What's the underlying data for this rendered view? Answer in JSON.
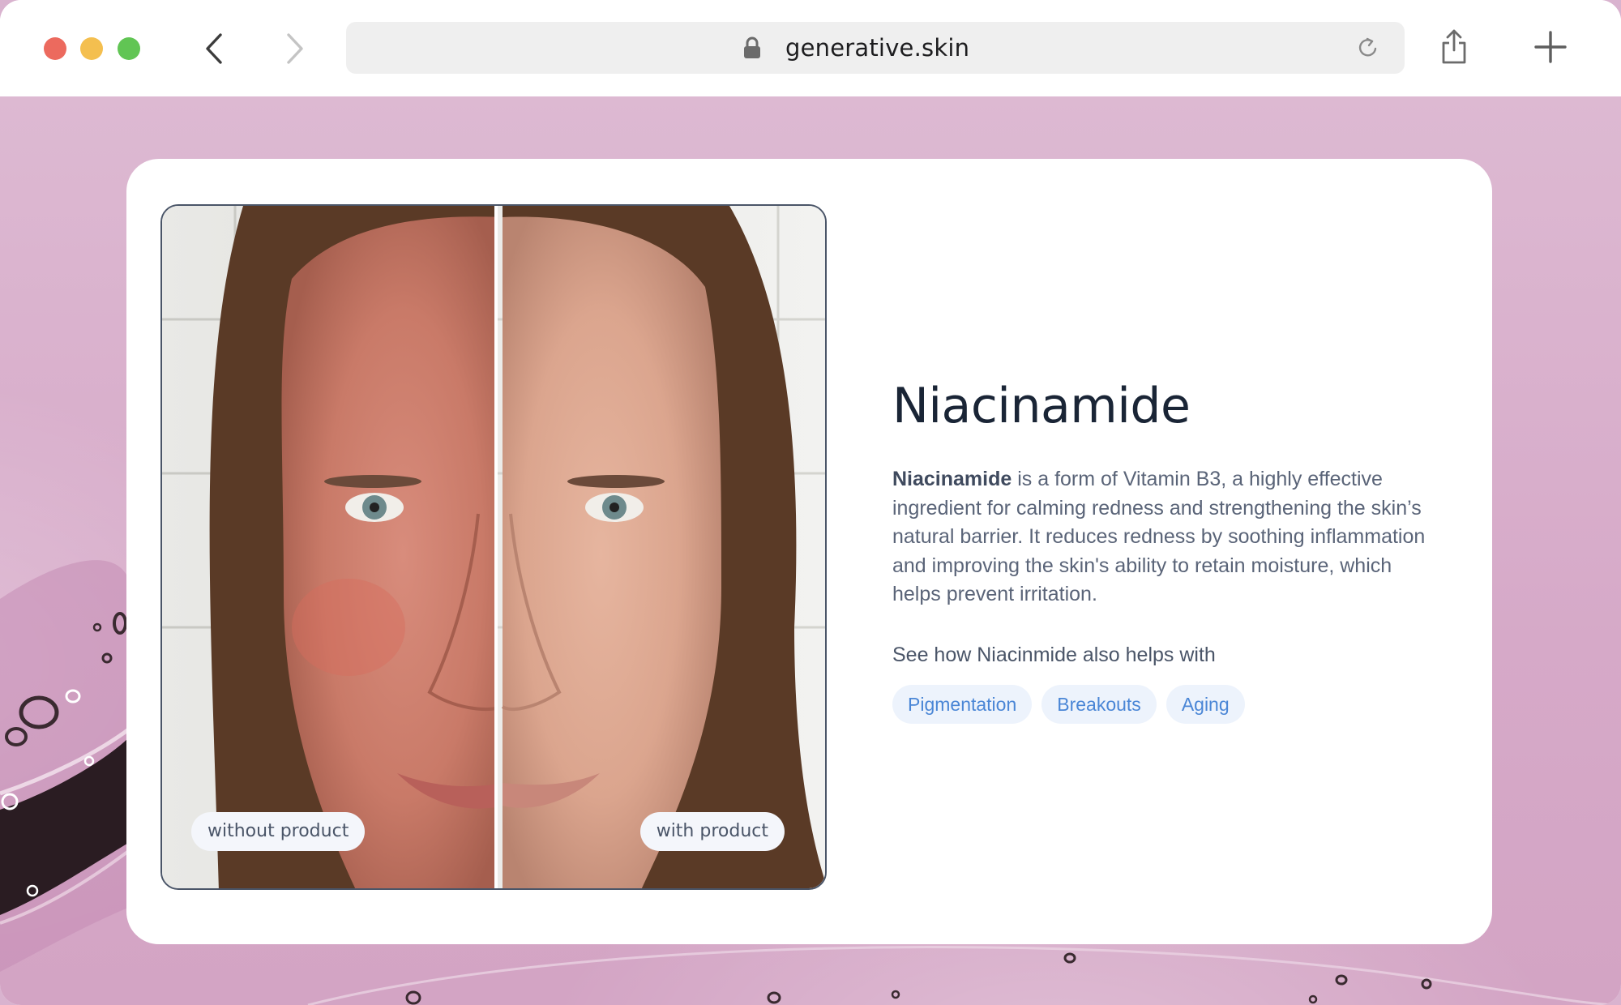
{
  "browser": {
    "url": "generative.skin",
    "icons": {
      "back": "chevron-left-icon",
      "forward": "chevron-right-icon",
      "lock": "lock-icon",
      "reload": "reload-icon",
      "share": "share-icon",
      "new_tab": "plus-icon"
    },
    "traffic_lights": {
      "close": "#ec6a5e",
      "minimize": "#f4bf4f",
      "maximize": "#61c554"
    }
  },
  "page": {
    "background_color": "#d9b3cf",
    "comparison": {
      "left_label": "without product",
      "right_label": "with product"
    },
    "ingredient": {
      "title": "Niacinamide",
      "description_bold": "Niacinamide",
      "description_rest": " is a form of Vitamin B3, a highly effective ingredient for calming redness and strengthening the skin’s natural barrier. It reduces redness by soothing inflammation and improving the skin's ability to retain moisture, which helps prevent irritation.",
      "helps_with_label": "See how Niacinmide also helps with",
      "tags": [
        "Pigmentation",
        "Breakouts",
        "Aging"
      ]
    },
    "colors": {
      "title": "#1a2536",
      "tag_text": "#4a86d6",
      "tag_bg": "#edf3fc"
    }
  }
}
